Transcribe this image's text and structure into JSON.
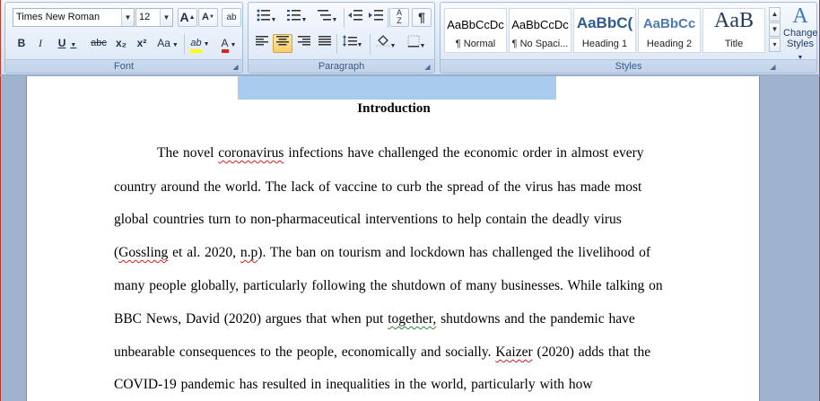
{
  "font_group": {
    "label": "Font",
    "font_name": "Times New Roman",
    "font_size": "12",
    "grow_font": "A",
    "shrink_font": "A",
    "clear_format": "ab",
    "bold": "B",
    "italic": "I",
    "underline": "U",
    "strike": "abc",
    "subscript": "x₂",
    "superscript": "x²",
    "change_case": "Aa",
    "highlight": "ab",
    "font_color": "A"
  },
  "paragraph_group": {
    "label": "Paragraph",
    "show_marks": "¶"
  },
  "styles_group": {
    "label": "Styles",
    "tiles": [
      {
        "sample": "AaBbCcDc",
        "name": "¶ Normal"
      },
      {
        "sample": "AaBbCcDc",
        "name": "¶ No Spaci..."
      },
      {
        "sample": "AaBbC(",
        "name": "Heading 1"
      },
      {
        "sample": "AaBbCc",
        "name": "Heading 2"
      },
      {
        "sample": "AaB",
        "name": "Title"
      }
    ],
    "change_styles_line1": "Change",
    "change_styles_line2": "Styles"
  },
  "colors": {
    "accent_highlight": "#ffff00",
    "font_color_bar": "#e02020",
    "selection": "#a9cbee"
  },
  "document": {
    "heading": "Introduction",
    "lines": {
      "l1a": "The novel ",
      "l1b": "coronavirus",
      "l1c": " infections have challenged the economic order in almost every",
      "l2": "country around the world. The lack of vaccine to curb the spread of the virus has made most",
      "l3": "global countries turn to non-pharmaceutical  interventions to help contain the deadly virus",
      "l4a": "(",
      "l4b": "Gossling",
      "l4c": " et al. 2020, ",
      "l4d": "n.p",
      "l4e": "). The ban on tourism and lockdown has challenged the livelihood of",
      "l5": "many people globally,  particularly following the shutdown of many businesses.  While talking on",
      "l6a": "BBC News, David (2020) argues that when put ",
      "l6b": "together,",
      "l6c": " shutdowns and the pandemic have",
      "l7a": "unbearable consequences to the people,  economically  and socially.  ",
      "l7b": "Kaizer",
      "l7c": " (2020) adds that the",
      "l8": "COVID-19 pandemic has resulted in  inequalities  in the world, particularly  with how"
    }
  }
}
